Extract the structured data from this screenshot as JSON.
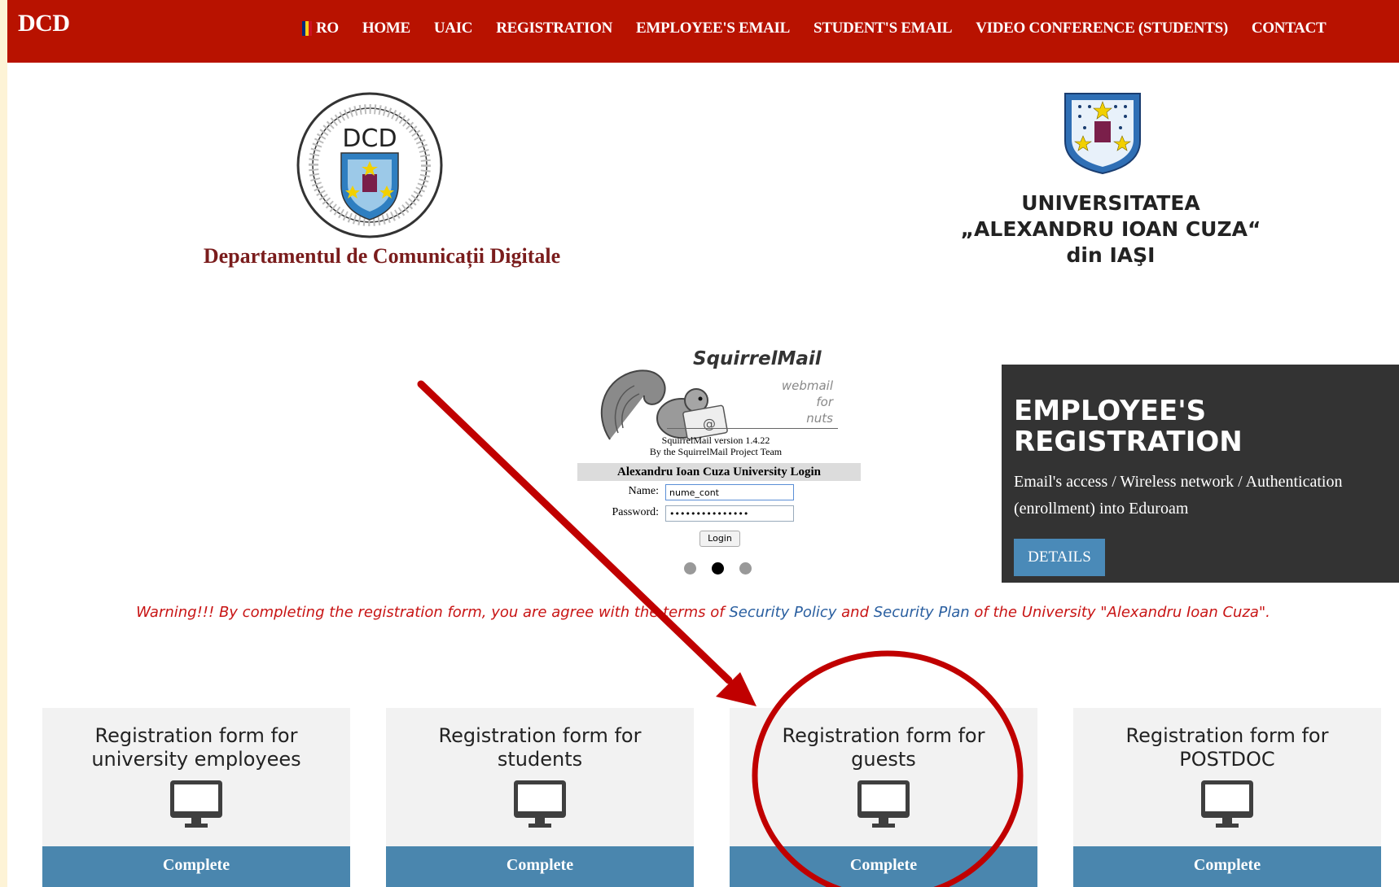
{
  "header": {
    "brand": "DCD",
    "nav": [
      {
        "label": "RO",
        "icon": "romania-flag-icon"
      },
      {
        "label": "HOME"
      },
      {
        "label": "UAIC"
      },
      {
        "label": "REGISTRATION"
      },
      {
        "label": "EMPLOYEE'S EMAIL"
      },
      {
        "label": "STUDENT'S EMAIL"
      },
      {
        "label": "VIDEO CONFERENCE (STUDENTS)"
      },
      {
        "label": "CONTACT"
      }
    ]
  },
  "logos": {
    "dcd_badge": "DCD",
    "dcd_name": "Departamentul de Comunicații Digitale",
    "uaic_line1": "UNIVERSITATEA",
    "uaic_line2": "„ALEXANDRU IOAN CUZA“",
    "uaic_line3": "din IAŞI"
  },
  "slider": {
    "title": "SquirrelMail",
    "sub1": "webmail",
    "sub2": "for",
    "sub3": "nuts",
    "version": "SquirrelMail version 1.4.22",
    "team": "By the SquirrelMail Project Team",
    "login_title": "Alexandru Ioan Cuza University Login",
    "name_label": "Name:",
    "name_value": "nume_cont",
    "password_label": "Password:",
    "password_value": "•••••••••••••••",
    "login_button": "Login",
    "dots": 3,
    "active_dot": 2
  },
  "promo": {
    "title_line1": "EMPLOYEE'S",
    "title_line2": "REGISTRATION",
    "text": "Email's access / Wireless network / Authentication (enrollment) into Eduroam",
    "button": "DETAILS"
  },
  "warning": {
    "pre": "Warning!!! By completing the registration form, you are agree with the terms of ",
    "link1": "Security Policy",
    "mid": " and ",
    "link2": "Security Plan",
    "post": " of the University \"Alexandru Ioan Cuza\"."
  },
  "cards": [
    {
      "line1": "Registration form for",
      "line2": "university employees",
      "button": "Complete",
      "icon": "computer-monitor-icon"
    },
    {
      "line1": "Registration form for",
      "line2": "students",
      "button": "Complete",
      "icon": "computer-monitor-icon"
    },
    {
      "line1": "Registration form for",
      "line2": "guests",
      "button": "Complete",
      "icon": "computer-monitor-icon"
    },
    {
      "line1": "Registration form for",
      "line2": "POSTDOC",
      "button": "Complete",
      "icon": "computer-monitor-icon"
    }
  ],
  "annotation": {
    "color": "#c00000",
    "highlighted_card": 3
  }
}
